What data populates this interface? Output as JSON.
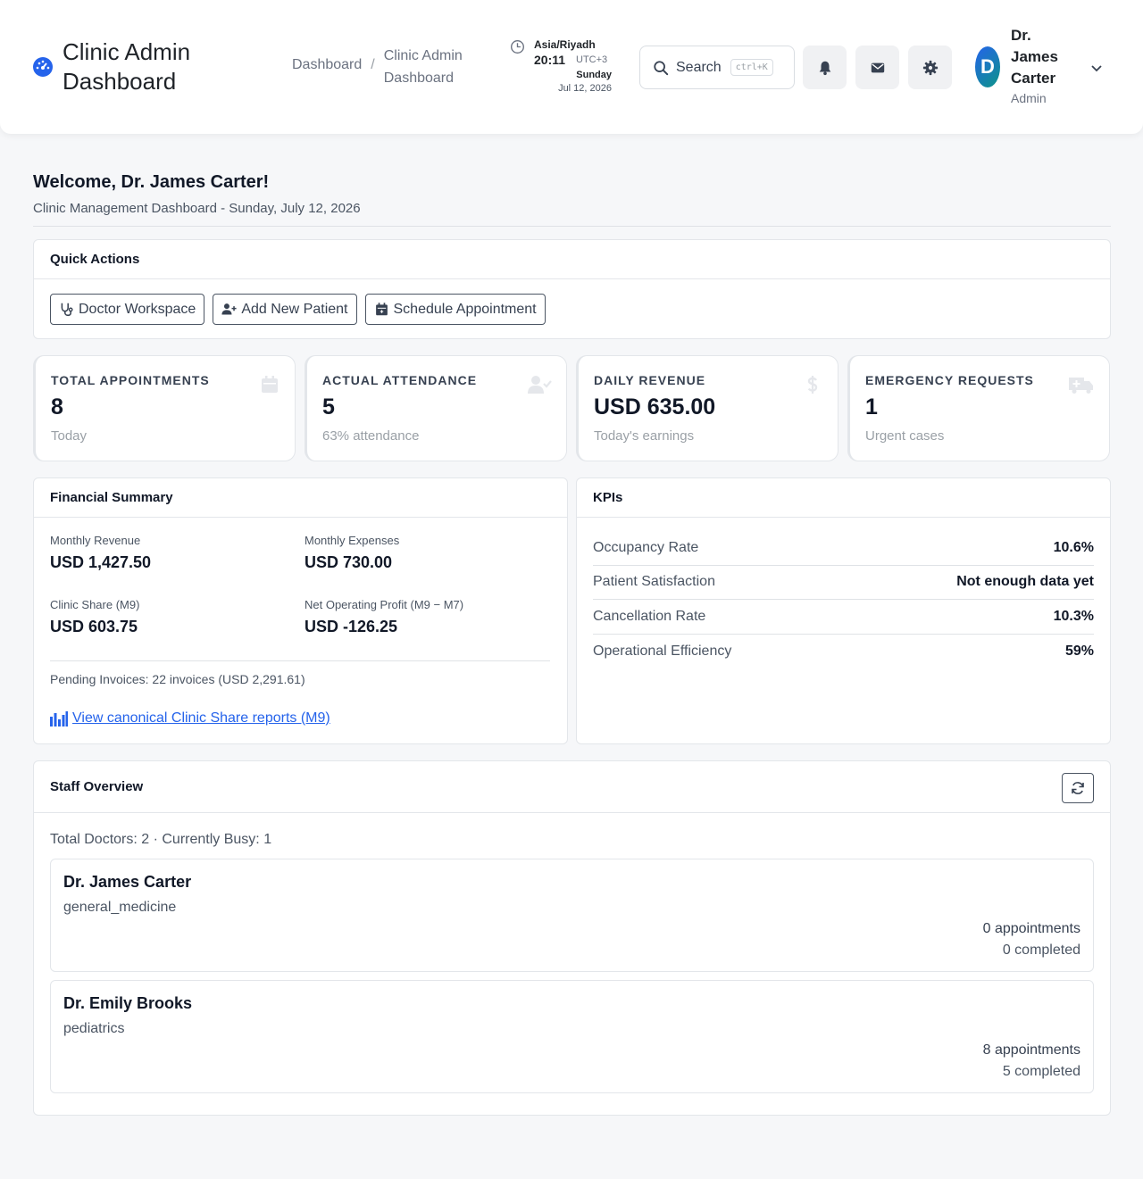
{
  "header": {
    "app_title": "Clinic Admin Dashboard",
    "breadcrumb": {
      "home": "Dashboard",
      "separator": "/",
      "current": "Clinic Admin Dashboard"
    },
    "clock": {
      "timezone": "Asia/Riyadh",
      "time": "20:11",
      "utc_offset": "UTC+3",
      "weekday": "Sunday",
      "date": "Jul 12, 2026"
    },
    "search": {
      "label": "Search",
      "shortcut": "ctrl+K"
    },
    "user": {
      "initial": "D",
      "name": "Dr. James Carter",
      "role": "Admin"
    }
  },
  "welcome": {
    "title": "Welcome, Dr. James Carter!",
    "subtitle": "Clinic Management Dashboard - Sunday, July 12, 2026"
  },
  "quick_actions": {
    "title": "Quick Actions",
    "buttons": [
      {
        "label": "Doctor Workspace",
        "icon": "stethoscope-icon"
      },
      {
        "label": "Add New Patient",
        "icon": "user-plus-icon"
      },
      {
        "label": "Schedule Appointment",
        "icon": "calendar-icon"
      }
    ]
  },
  "stats": [
    {
      "label": "TOTAL APPOINTMENTS",
      "value": "8",
      "sub": "Today",
      "icon": "calendar-icon"
    },
    {
      "label": "ACTUAL ATTENDANCE",
      "value": "5",
      "sub": "63% attendance",
      "icon": "user-check-icon"
    },
    {
      "label": "DAILY REVENUE",
      "value": "USD 635.00",
      "sub": "Today's earnings",
      "icon": "dollar-icon"
    },
    {
      "label": "EMERGENCY REQUESTS",
      "value": "1",
      "sub": "Urgent cases",
      "icon": "ambulance-icon"
    }
  ],
  "financial_summary": {
    "title": "Financial Summary",
    "items": [
      {
        "label": "Monthly Revenue",
        "value": "USD 1,427.50"
      },
      {
        "label": "Monthly Expenses",
        "value": "USD 730.00"
      },
      {
        "label": "Clinic Share (M9)",
        "value": "USD 603.75"
      },
      {
        "label": "Net Operating Profit (M9 − M7)",
        "value": "USD -126.25"
      }
    ],
    "pending": "Pending Invoices: 22 invoices (USD 2,291.61)",
    "link_label": "View canonical Clinic Share reports (M9)"
  },
  "kpis": {
    "title": "KPIs",
    "rows": [
      {
        "label": "Occupancy Rate",
        "value": "10.6%"
      },
      {
        "label": "Patient Satisfaction",
        "value": "Not enough data yet"
      },
      {
        "label": "Cancellation Rate",
        "value": "10.3%"
      },
      {
        "label": "Operational Efficiency",
        "value": "59%"
      }
    ]
  },
  "staff": {
    "title": "Staff Overview",
    "summary": "Total Doctors: 2 · Currently Busy: 1",
    "doctors": [
      {
        "name": "Dr. James Carter",
        "specialty": "general_medicine",
        "appointments": "0 appointments",
        "completed": "0 completed"
      },
      {
        "name": "Dr. Emily Brooks",
        "specialty": "pediatrics",
        "appointments": "8 appointments",
        "completed": "5 completed"
      }
    ]
  },
  "colors": {
    "accent": "#2563eb",
    "text": "#111827",
    "muted": "#4b5563",
    "border": "#e3e6ea"
  }
}
